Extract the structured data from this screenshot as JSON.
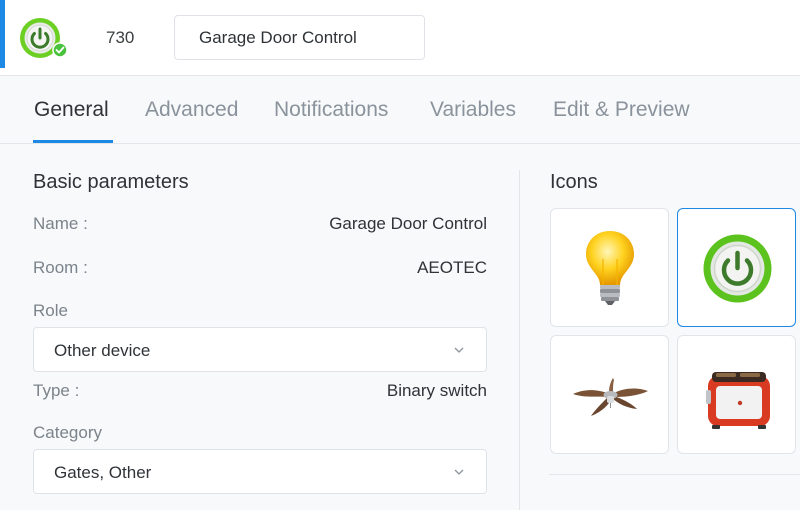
{
  "header": {
    "device_id": "730",
    "device_name_value": "Garage Door Control",
    "device_icon": "power-button-icon"
  },
  "tabs": [
    {
      "label": "General",
      "active": true
    },
    {
      "label": "Advanced",
      "active": false
    },
    {
      "label": "Notifications",
      "active": false
    },
    {
      "label": "Variables",
      "active": false
    },
    {
      "label": "Edit & Preview",
      "active": false
    }
  ],
  "basic": {
    "title": "Basic parameters",
    "name_label": "Name :",
    "name_value": "Garage Door Control",
    "room_label": "Room :",
    "room_value": "AEOTEC",
    "role_label": "Role",
    "role_value": "Other device",
    "type_label": "Type :",
    "type_value": "Binary switch",
    "category_label": "Category",
    "category_value": "Gates, Other"
  },
  "icons": {
    "title": "Icons",
    "items": [
      {
        "name": "light-bulb-icon",
        "selected": false
      },
      {
        "name": "power-button-icon",
        "selected": true
      },
      {
        "name": "ceiling-fan-icon",
        "selected": false
      },
      {
        "name": "toaster-icon",
        "selected": false
      }
    ]
  },
  "colors": {
    "accent": "#1e88e5",
    "power_green": "#5cc21e"
  }
}
